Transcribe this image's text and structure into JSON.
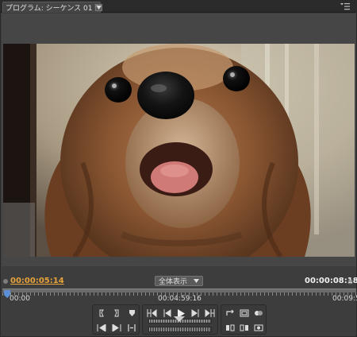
{
  "tab": {
    "title": "プログラム: シーケンス 01"
  },
  "timecodes": {
    "current": "00:00:05:14",
    "duration": "00:00:08:18"
  },
  "zoom": {
    "selected": "全体表示"
  },
  "ruler": {
    "start": "00:00",
    "middle": "00:04:59:16",
    "end": "00:09:5"
  },
  "colors": {
    "current_timecode": "#e8a33a",
    "panel_bg": "#3d3d3d",
    "tab_bar_bg": "#2b2b2b"
  },
  "icons": {
    "tab_menu": "panel-menu-icon",
    "playhead": "playhead-icon",
    "controls": [
      "mark-in-icon",
      "mark-out-icon",
      "set-marker-icon",
      "go-to-in-icon",
      "step-back-icon",
      "play-icon",
      "step-forward-icon",
      "go-to-out-icon",
      "loop-icon",
      "safe-margins-icon",
      "output-icon",
      "play-in-to-out-icon",
      "go-to-previous-edit-icon",
      "go-to-next-edit-icon",
      "lift-icon",
      "extract-icon",
      "export-frame-icon"
    ]
  }
}
